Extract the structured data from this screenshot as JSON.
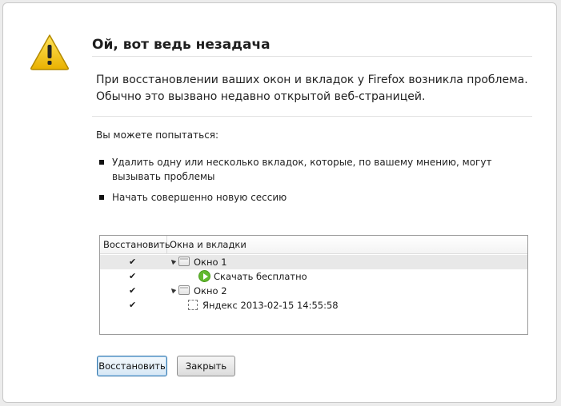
{
  "dialog": {
    "title": "Ой, вот ведь незадача",
    "message_line1": "При восстановлении ваших окон и вкладок у Firefox возникла проблема.",
    "message_line2": "Обычно это вызвано недавно открытой веб-страницей.",
    "try_label": "Вы можете попытаться:",
    "suggestions": [
      "Удалить одну или несколько вкладок, которые, по вашему мнению, могут вызывать проблемы",
      "Начать совершенно новую сессию"
    ]
  },
  "tree": {
    "col_restore": "Восстановить",
    "col_windows": "Окна и вкладки",
    "rows": [
      {
        "checked": true,
        "label": "Окно 1",
        "kind": "window",
        "selected": true
      },
      {
        "checked": true,
        "label": "Скачать  бесплатно",
        "kind": "tab-green"
      },
      {
        "checked": true,
        "label": "Окно 2",
        "kind": "window"
      },
      {
        "checked": true,
        "label": "Яндекс 2013-02-15 14:55:58",
        "kind": "tab-page"
      }
    ],
    "check_glyph": "✔"
  },
  "buttons": {
    "restore_label": "Восстановить",
    "close_label": "Закрыть"
  },
  "icons": {
    "warning": "warning-triangle-icon",
    "window": "window-icon",
    "tab_green": "download-play-icon",
    "tab_page": "blank-page-icon"
  },
  "colors": {
    "warning_fill": "#f5c400",
    "focus_border": "#3d7bad",
    "tab_green": "#62b92f"
  }
}
